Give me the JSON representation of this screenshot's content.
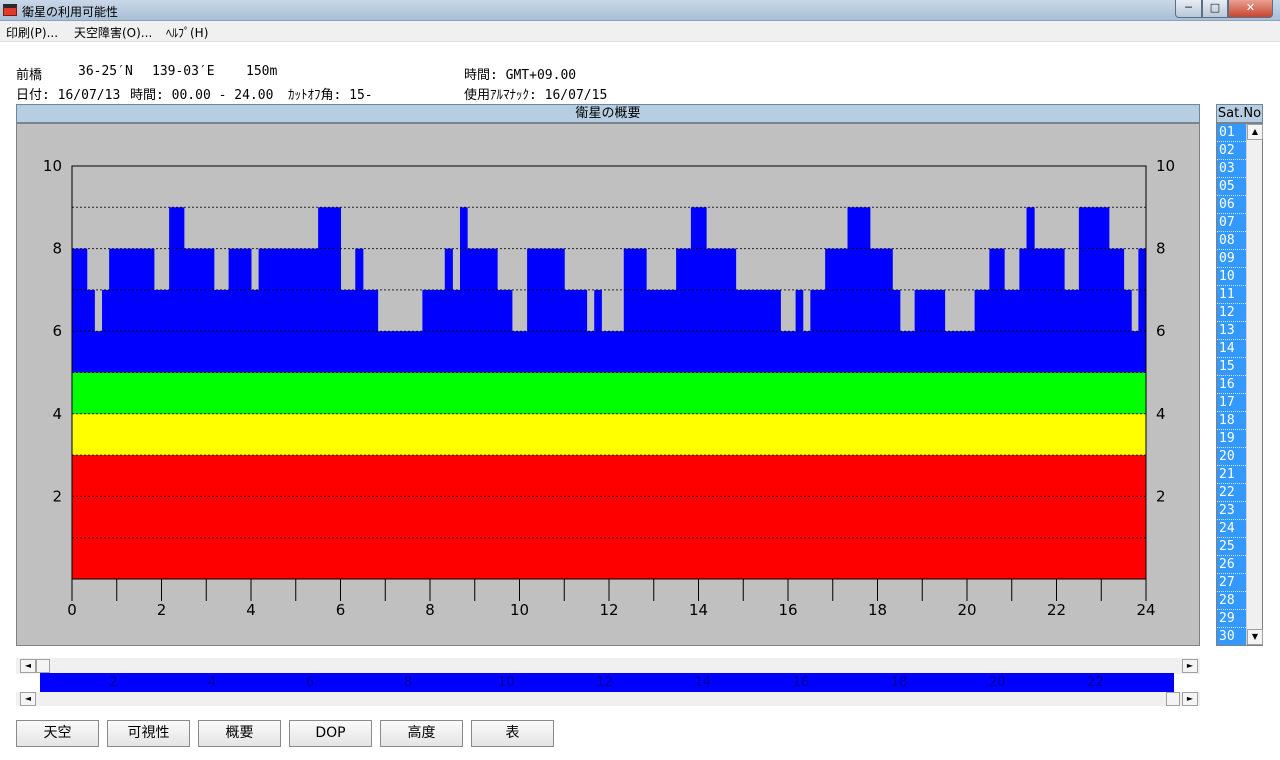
{
  "window": {
    "title": "衛星の利用可能性",
    "min": "─",
    "max": "□",
    "close": "✕"
  },
  "menu": [
    "印刷(P)...",
    "天空障害(O)...",
    "ﾍﾙﾌﾟ(H)"
  ],
  "header": {
    "location": "前橋",
    "latitude": "36-25′N",
    "longitude": "139-03′E",
    "altitude": "150m",
    "time_zone": "時間: GMT+09.00",
    "date": "日付: 16/07/13",
    "time_range": "時間: 00.00 - 24.00",
    "cutoff": "ｶｯﾄｵﾌ角: 15-",
    "almanac": "使用ｱﾙﾏﾅｯｸ: 16/07/15"
  },
  "panel_title": "衛星の概要",
  "sat_list": {
    "header": "Sat.No",
    "items": [
      "01",
      "02",
      "03",
      "05",
      "06",
      "07",
      "08",
      "09",
      "10",
      "11",
      "12",
      "13",
      "14",
      "15",
      "16",
      "17",
      "18",
      "19",
      "20",
      "21",
      "22",
      "23",
      "24",
      "25",
      "26",
      "27",
      "28",
      "29",
      "30"
    ]
  },
  "chart_data": {
    "type": "area",
    "xlim": [
      0,
      24
    ],
    "ylim": [
      0,
      10
    ],
    "x_ticks": [
      0,
      2,
      4,
      6,
      8,
      10,
      12,
      14,
      16,
      18,
      20,
      22,
      24
    ],
    "y_ticks": [
      2,
      4,
      6,
      8,
      10
    ],
    "grid": true,
    "bands": [
      {
        "from": 0,
        "to": 3,
        "color": "#ff0000"
      },
      {
        "from": 3,
        "to": 4,
        "color": "#ffff00"
      },
      {
        "from": 4,
        "to": 5,
        "color": "#00ff00"
      }
    ],
    "satellites_color": "#0000ff",
    "background_color": "#c0c0c0",
    "satellites_series": [
      {
        "x0": 0.0,
        "x1": 0.33,
        "y": 8
      },
      {
        "x0": 0.33,
        "x1": 0.5,
        "y": 7
      },
      {
        "x0": 0.5,
        "x1": 0.67,
        "y": 6
      },
      {
        "x0": 0.67,
        "x1": 0.83,
        "y": 7
      },
      {
        "x0": 0.83,
        "x1": 1.83,
        "y": 8
      },
      {
        "x0": 1.83,
        "x1": 2.17,
        "y": 7
      },
      {
        "x0": 2.17,
        "x1": 2.5,
        "y": 9
      },
      {
        "x0": 2.5,
        "x1": 3.17,
        "y": 8
      },
      {
        "x0": 3.17,
        "x1": 3.5,
        "y": 7
      },
      {
        "x0": 3.5,
        "x1": 4.0,
        "y": 8
      },
      {
        "x0": 4.0,
        "x1": 4.17,
        "y": 7
      },
      {
        "x0": 4.17,
        "x1": 5.5,
        "y": 8
      },
      {
        "x0": 5.5,
        "x1": 6.0,
        "y": 9
      },
      {
        "x0": 6.0,
        "x1": 6.33,
        "y": 7
      },
      {
        "x0": 6.33,
        "x1": 6.5,
        "y": 8
      },
      {
        "x0": 6.5,
        "x1": 6.83,
        "y": 7
      },
      {
        "x0": 6.83,
        "x1": 7.83,
        "y": 6
      },
      {
        "x0": 7.83,
        "x1": 8.33,
        "y": 7
      },
      {
        "x0": 8.33,
        "x1": 8.5,
        "y": 8
      },
      {
        "x0": 8.5,
        "x1": 8.67,
        "y": 7
      },
      {
        "x0": 8.67,
        "x1": 8.83,
        "y": 9
      },
      {
        "x0": 8.83,
        "x1": 9.5,
        "y": 8
      },
      {
        "x0": 9.5,
        "x1": 9.83,
        "y": 7
      },
      {
        "x0": 9.83,
        "x1": 10.17,
        "y": 6
      },
      {
        "x0": 10.17,
        "x1": 11.0,
        "y": 8
      },
      {
        "x0": 11.0,
        "x1": 11.5,
        "y": 7
      },
      {
        "x0": 11.5,
        "x1": 11.67,
        "y": 6
      },
      {
        "x0": 11.67,
        "x1": 11.83,
        "y": 7
      },
      {
        "x0": 11.83,
        "x1": 12.33,
        "y": 6
      },
      {
        "x0": 12.33,
        "x1": 12.83,
        "y": 8
      },
      {
        "x0": 12.83,
        "x1": 13.5,
        "y": 7
      },
      {
        "x0": 13.5,
        "x1": 13.83,
        "y": 8
      },
      {
        "x0": 13.83,
        "x1": 14.17,
        "y": 9
      },
      {
        "x0": 14.17,
        "x1": 14.83,
        "y": 8
      },
      {
        "x0": 14.83,
        "x1": 15.83,
        "y": 7
      },
      {
        "x0": 15.83,
        "x1": 16.17,
        "y": 6
      },
      {
        "x0": 16.17,
        "x1": 16.33,
        "y": 7
      },
      {
        "x0": 16.33,
        "x1": 16.5,
        "y": 6
      },
      {
        "x0": 16.5,
        "x1": 16.83,
        "y": 7
      },
      {
        "x0": 16.83,
        "x1": 17.33,
        "y": 8
      },
      {
        "x0": 17.33,
        "x1": 17.83,
        "y": 9
      },
      {
        "x0": 17.83,
        "x1": 18.33,
        "y": 8
      },
      {
        "x0": 18.33,
        "x1": 18.5,
        "y": 7
      },
      {
        "x0": 18.5,
        "x1": 18.83,
        "y": 6
      },
      {
        "x0": 18.83,
        "x1": 19.5,
        "y": 7
      },
      {
        "x0": 19.5,
        "x1": 20.17,
        "y": 6
      },
      {
        "x0": 20.17,
        "x1": 20.5,
        "y": 7
      },
      {
        "x0": 20.5,
        "x1": 20.83,
        "y": 8
      },
      {
        "x0": 20.83,
        "x1": 21.17,
        "y": 7
      },
      {
        "x0": 21.17,
        "x1": 21.33,
        "y": 8
      },
      {
        "x0": 21.33,
        "x1": 21.5,
        "y": 9
      },
      {
        "x0": 21.5,
        "x1": 22.17,
        "y": 8
      },
      {
        "x0": 22.17,
        "x1": 22.5,
        "y": 7
      },
      {
        "x0": 22.5,
        "x1": 23.17,
        "y": 9
      },
      {
        "x0": 23.17,
        "x1": 23.5,
        "y": 8
      },
      {
        "x0": 23.5,
        "x1": 23.67,
        "y": 7
      },
      {
        "x0": 23.67,
        "x1": 23.83,
        "y": 6
      },
      {
        "x0": 23.83,
        "x1": 24.0,
        "y": 8
      }
    ]
  },
  "timeline": {
    "ticks": [
      2,
      4,
      6,
      8,
      10,
      12,
      14,
      16,
      18,
      20,
      22
    ],
    "left_arrow": "◄",
    "right_arrow": "►"
  },
  "buttons": [
    "天空",
    "可視性",
    "概要",
    "DOP",
    "高度",
    "表"
  ]
}
